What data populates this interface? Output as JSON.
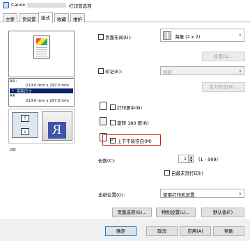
{
  "title": {
    "prefix": "Canon",
    "suffix": "打印首选项"
  },
  "tabs": [
    "主要",
    "页设置",
    "版式",
    "收藏",
    "维护"
  ],
  "preview": {
    "info_lines": [
      "A4 :",
      "210.0 mm x 297.0 mm",
      "实际尺寸",
      "A4",
      "210.0 mm x 297.0 mm"
    ]
  },
  "page_layout": {
    "label": "页面布局(U):",
    "value": "海报 (2 x 2)",
    "settings_button": "设置(S)..."
  },
  "stamp": {
    "label": "印记(E):",
    "value": "保密",
    "define_button": "定义印记(D)..."
  },
  "print_center": {
    "label": "打印居中(N)"
  },
  "rotate": {
    "label": "旋转 180 度(R)"
  },
  "no_margin": {
    "label": "上下不装空白(M)",
    "checked": true
  },
  "copies": {
    "label": "份数(C):",
    "value": "1",
    "range": "(1 - 999)"
  },
  "last_page_first": {
    "label": "自最末页打印(I)"
  },
  "output_tray": {
    "label": "出纸位置(O):",
    "value": "使用打印机设置"
  },
  "actions": {
    "page_options": "页面选项(G)...",
    "special_settings": "特别设置(L)...",
    "defaults": "默认值(F)"
  },
  "footer": {
    "ok": "确定",
    "cancel": "取消",
    "apply": "应用(A)",
    "help": "帮助"
  },
  "icons": [
    "printer-icon",
    "arrow-up-icon",
    "arrow-down-icon",
    "duplex-icon",
    "rotate-icon",
    "center-icon"
  ]
}
